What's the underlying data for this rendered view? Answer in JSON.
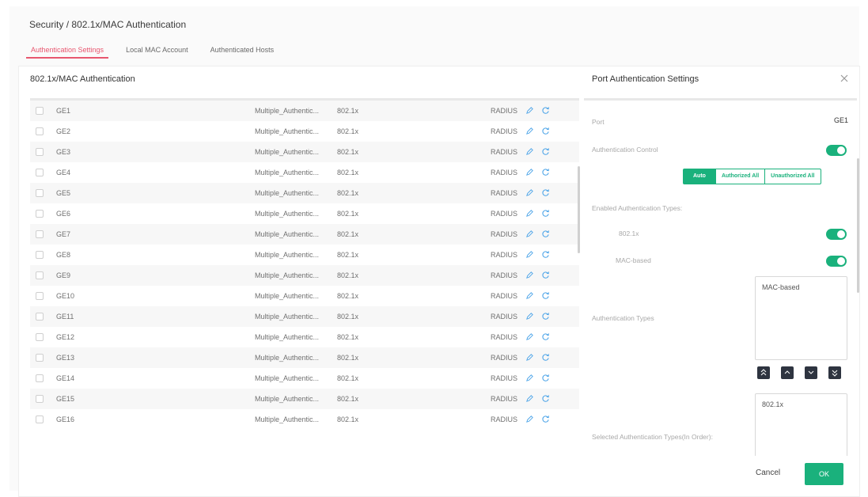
{
  "breadcrumb": {
    "section": "Security",
    "separator": "/",
    "page": "802.1x/MAC Authentication"
  },
  "tabs": [
    {
      "label": "Authentication Settings",
      "active": true
    },
    {
      "label": "Local MAC Account",
      "active": false
    },
    {
      "label": "Authenticated Hosts",
      "active": false
    }
  ],
  "table": {
    "title": "802.1x/MAC Authentication",
    "rows": [
      {
        "port": "GE1",
        "mode": "Multiple_Authentic...",
        "type": "802.1x",
        "server": "RADIUS"
      },
      {
        "port": "GE2",
        "mode": "Multiple_Authentic...",
        "type": "802.1x",
        "server": "RADIUS"
      },
      {
        "port": "GE3",
        "mode": "Multiple_Authentic...",
        "type": "802.1x",
        "server": "RADIUS"
      },
      {
        "port": "GE4",
        "mode": "Multiple_Authentic...",
        "type": "802.1x",
        "server": "RADIUS"
      },
      {
        "port": "GE5",
        "mode": "Multiple_Authentic...",
        "type": "802.1x",
        "server": "RADIUS"
      },
      {
        "port": "GE6",
        "mode": "Multiple_Authentic...",
        "type": "802.1x",
        "server": "RADIUS"
      },
      {
        "port": "GE7",
        "mode": "Multiple_Authentic...",
        "type": "802.1x",
        "server": "RADIUS"
      },
      {
        "port": "GE8",
        "mode": "Multiple_Authentic...",
        "type": "802.1x",
        "server": "RADIUS"
      },
      {
        "port": "GE9",
        "mode": "Multiple_Authentic...",
        "type": "802.1x",
        "server": "RADIUS"
      },
      {
        "port": "GE10",
        "mode": "Multiple_Authentic...",
        "type": "802.1x",
        "server": "RADIUS"
      },
      {
        "port": "GE11",
        "mode": "Multiple_Authentic...",
        "type": "802.1x",
        "server": "RADIUS"
      },
      {
        "port": "GE12",
        "mode": "Multiple_Authentic...",
        "type": "802.1x",
        "server": "RADIUS"
      },
      {
        "port": "GE13",
        "mode": "Multiple_Authentic...",
        "type": "802.1x",
        "server": "RADIUS"
      },
      {
        "port": "GE14",
        "mode": "Multiple_Authentic...",
        "type": "802.1x",
        "server": "RADIUS"
      },
      {
        "port": "GE15",
        "mode": "Multiple_Authentic...",
        "type": "802.1x",
        "server": "RADIUS"
      },
      {
        "port": "GE16",
        "mode": "Multiple_Authentic...",
        "type": "802.1x",
        "server": "RADIUS"
      }
    ]
  },
  "side_panel": {
    "title": "Port Authentication Settings",
    "port_label": "Port",
    "port_value": "GE1",
    "auth_control_label": "Authentication Control",
    "auth_control_on": true,
    "control_options": [
      "Auto",
      "Authorized All",
      "Unauthorized All"
    ],
    "control_selected": "Auto",
    "enabled_types_label": "Enabled Authentication Types:",
    "type_8021x_label": "802.1x",
    "type_8021x_on": true,
    "type_mac_label": "MAC-based",
    "type_mac_on": true,
    "auth_types_label": "Authentication Types",
    "auth_types_items": [
      "MAC-based"
    ],
    "selected_types_label": "Selected Authentication Types(In Order):",
    "selected_types_items": [
      "802.1x"
    ]
  },
  "footer": {
    "cancel_label": "Cancel",
    "ok_label": "OK"
  },
  "colors": {
    "accent": "#1ab17c",
    "tab_active": "#e8566f",
    "icon_blue": "#4aa3e8"
  }
}
